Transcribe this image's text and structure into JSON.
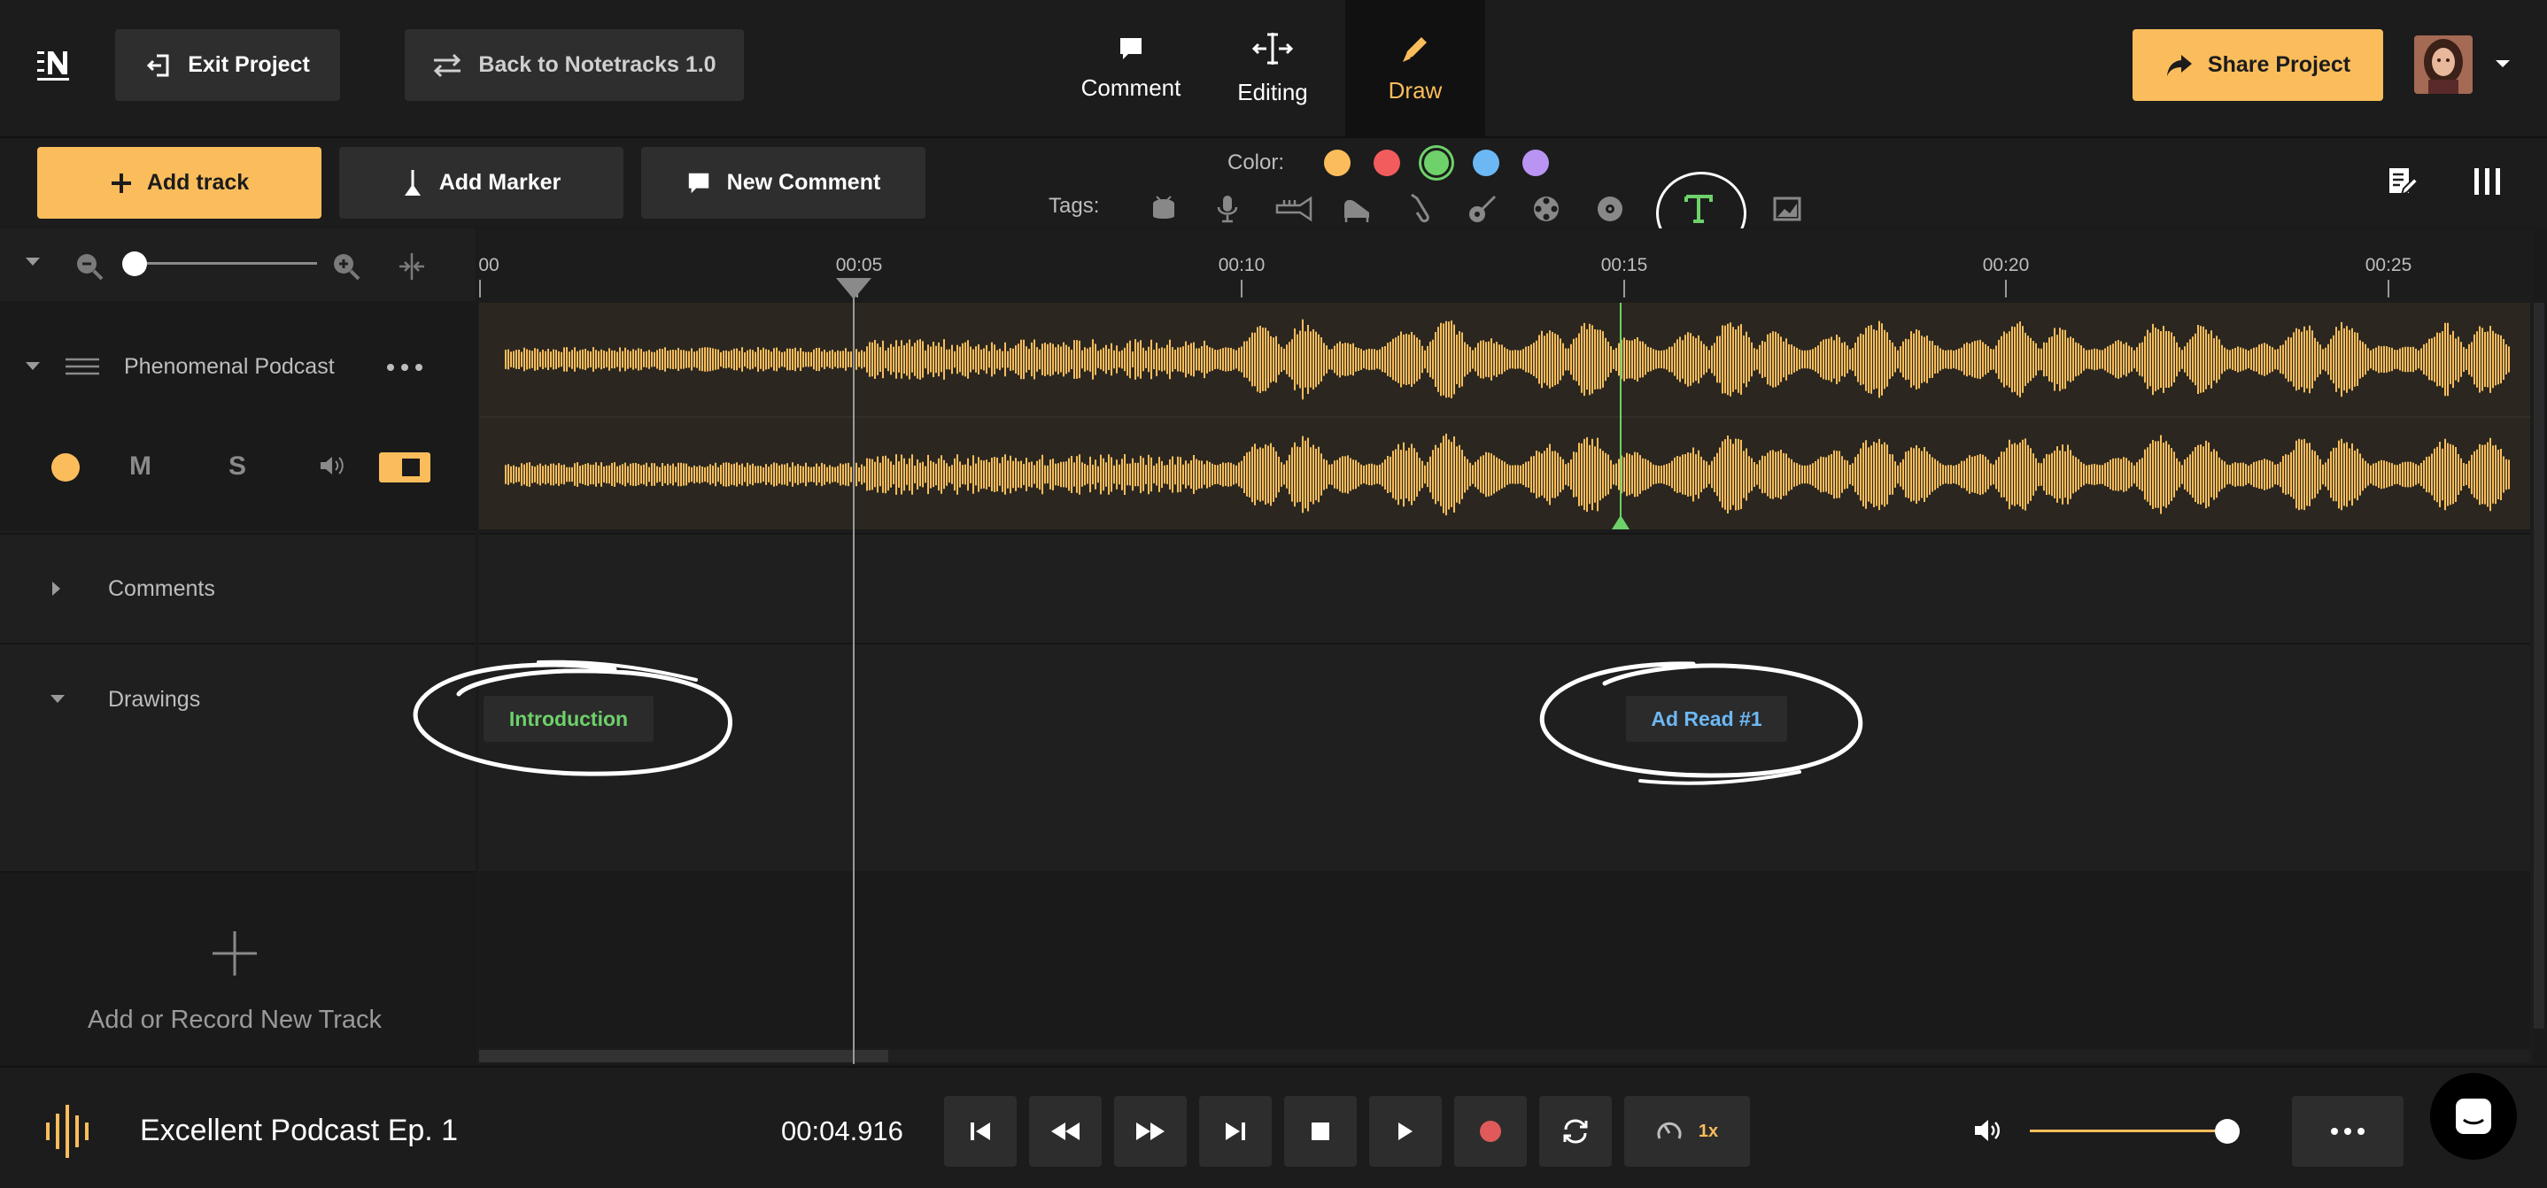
{
  "header": {
    "exit_project": "Exit Project",
    "back_to_v1": "Back to Notetracks 1.0",
    "modes": [
      {
        "label": "Comment",
        "icon": "comment-icon"
      },
      {
        "label": "Editing",
        "icon": "trim-icon"
      },
      {
        "label": "Draw",
        "icon": "pencil-icon",
        "active": true
      }
    ],
    "share_project": "Share Project"
  },
  "toolbar": {
    "add_track": "Add track",
    "add_marker": "Add Marker",
    "new_comment": "New Comment",
    "color_label": "Color:",
    "tags_label": "Tags:",
    "colors": [
      "#fbbd5b",
      "#f25c5c",
      "#6ed16a",
      "#6cb8f5",
      "#b994f2"
    ],
    "selected_color_index": 2,
    "tags": [
      "drum-icon",
      "microphone-icon",
      "trumpet-icon",
      "piano-icon",
      "saxophone-icon",
      "guitar-icon",
      "film-reel-icon",
      "vinyl-record-icon",
      "text-icon",
      "image-icon"
    ],
    "selected_tag": "text-icon"
  },
  "timeline": {
    "ticks": [
      "00",
      "00:05",
      "00:10",
      "00:15",
      "00:20",
      "00:25"
    ],
    "zoom_level": 0.0
  },
  "tracks": {
    "audio_track_name": "Phenomenal Podcast",
    "mute_label": "M",
    "solo_label": "S",
    "accent": "#fbbd5b",
    "comments_label": "Comments",
    "drawings_label": "Drawings",
    "markers": [
      {
        "label": "Introduction",
        "color": "#6ed16a"
      },
      {
        "label": "Ad Read #1",
        "color": "#6cb8f5"
      }
    ],
    "add_track_label": "Add or Record New Track"
  },
  "transport": {
    "title": "Excellent Podcast Ep. 1",
    "time": "00:04.916",
    "speed": "1x",
    "volume": 0.98
  }
}
